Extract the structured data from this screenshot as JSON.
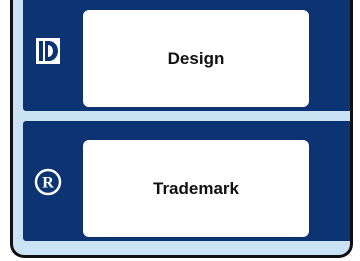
{
  "categories": [
    {
      "label": "Design",
      "icon": "design-d-icon"
    },
    {
      "label": "Trademark",
      "icon": "registered-trademark-icon"
    }
  ],
  "colors": {
    "row_background": "#0c3472",
    "panel_background": "#c9e3f4",
    "card_background": "#ffffff",
    "border": "#111111"
  }
}
